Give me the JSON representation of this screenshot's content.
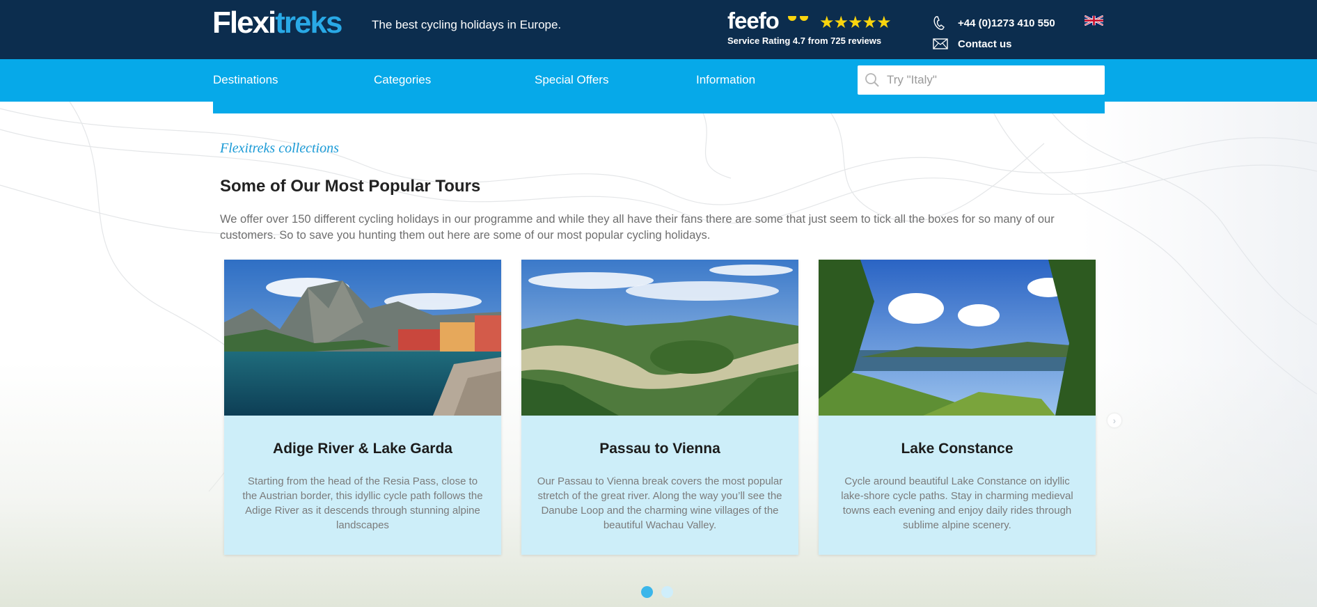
{
  "header": {
    "logo_part1": "Flexi",
    "logo_part2": "treks",
    "tagline": "The best cycling holidays in Europe.",
    "feefo": {
      "brand": "feefo",
      "stars": "★★★★★",
      "rating_text": "Service Rating 4.7 from 725 reviews"
    },
    "phone": "+44 (0)1273 410 550",
    "contact_label": "Contact us",
    "language_icon": "uk-flag-icon"
  },
  "nav": {
    "items": [
      "Destinations",
      "Categories",
      "Special Offers",
      "Information"
    ],
    "search_placeholder": "Try \"Italy\""
  },
  "main": {
    "kicker": "Flexitreks collections",
    "title": "Some of Our Most Popular Tours",
    "intro": "We offer over 150 different cycling holidays in our programme and while they all have their fans there are some that just seem to tick all the boxes for so many of our customers. So to save you hunting them out here are some of our most popular cycling holidays.",
    "cards": [
      {
        "title": "Adige River & Lake Garda",
        "description": "Starting from the head of the Resia Pass, close to the Austrian border, this idyllic cycle path follows the Adige River as it descends through stunning alpine landscapes"
      },
      {
        "title": "Passau to Vienna",
        "description": "Our Passau to Vienna break covers the most popular stretch of the great river. Along the way you’ll see the Danube Loop and the charming wine villages of the beautiful Wachau Valley."
      },
      {
        "title": "Lake Constance",
        "description": "Cycle around beautiful Lake Constance on idyllic lake-shore cycle paths. Stay in charming medieval towns each evening and enjoy daily rides through sublime alpine scenery."
      }
    ],
    "carousel": {
      "pages": 2,
      "active_page": 1
    }
  },
  "colors": {
    "header_dark": "#0c2d4e",
    "nav_blue": "#06a9e9",
    "card_bg": "#cdeef9",
    "accent": "#1a9ad6",
    "star_yellow": "#f9d40e"
  }
}
